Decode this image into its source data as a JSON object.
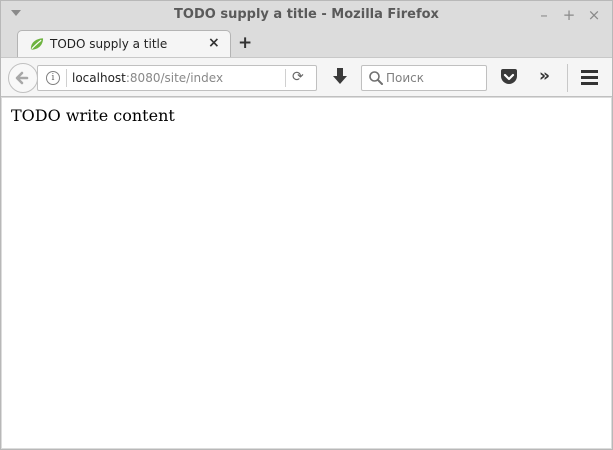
{
  "window": {
    "title": "TODO supply a title - Mozilla Firefox",
    "controls": {
      "minimize": "–",
      "maximize": "+",
      "close": "×"
    }
  },
  "tabs": [
    {
      "label": "TODO supply a title",
      "close": "×",
      "favicon": "spring-leaf-icon",
      "favicon_color": "#6db33f"
    }
  ],
  "new_tab_label": "+",
  "navbar": {
    "url_host": "localhost",
    "url_rest": ":8080/site/index",
    "info_icon": "i",
    "reload_icon": "⟳",
    "search_placeholder": "Поиск",
    "overflow_icon": "»"
  },
  "page": {
    "body_text": "TODO write content"
  },
  "colors": {
    "chrome": "#dcdcdc",
    "toolbar": "#f5f5f5",
    "content_bg": "#ffffff"
  }
}
